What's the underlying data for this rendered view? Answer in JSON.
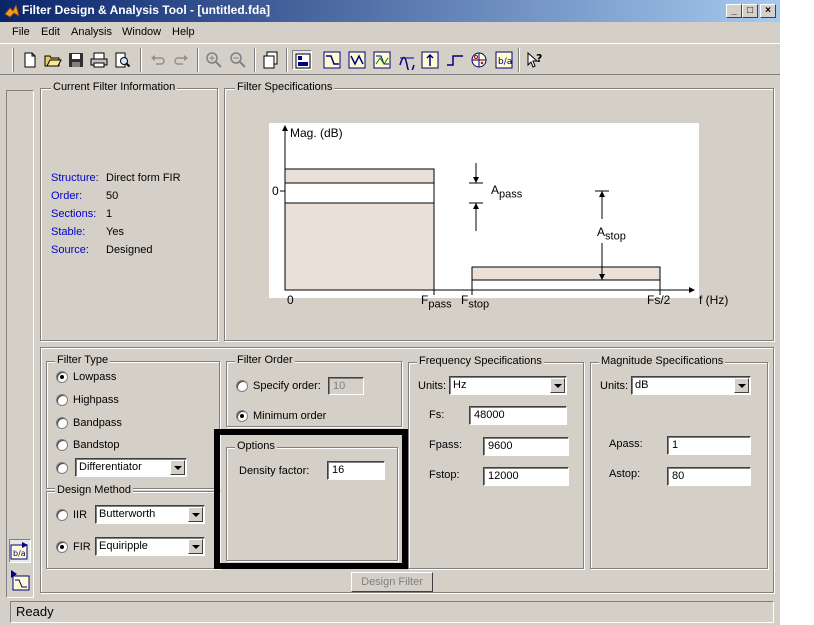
{
  "window": {
    "title": "Filter Design & Analysis Tool - [untitled.fda]"
  },
  "titlebar_buttons": {
    "minimize": "_",
    "maximize": "□",
    "close": "×"
  },
  "menu": [
    "File",
    "Edit",
    "Analysis",
    "Window",
    "Help"
  ],
  "toolbar_icons": [
    "new-icon",
    "open-icon",
    "save-icon",
    "print-icon",
    "print-preview-icon",
    "undo-icon",
    "redo-icon",
    "zoom-in-icon",
    "zoom-out-icon",
    "new-figure-icon",
    "full-view-icon",
    "magnitude-response-icon",
    "phase-response-icon",
    "magnitude-phase-icon",
    "group-delay-icon",
    "impulse-response-icon",
    "step-response-icon",
    "pole-zero-icon",
    "filter-coefficients-icon",
    "whats-this-icon"
  ],
  "current_filter": {
    "legend": "Current Filter Information",
    "rows": [
      {
        "label": "Structure:",
        "value": "Direct form FIR"
      },
      {
        "label": "Order:",
        "value": "50"
      },
      {
        "label": "Sections:",
        "value": "1"
      },
      {
        "label": "Stable:",
        "value": "Yes"
      },
      {
        "label": "Source:",
        "value": "Designed"
      }
    ]
  },
  "filter_specs": {
    "legend": "Filter Specifications",
    "ylabel": "Mag. (dB)",
    "zero_y": "0",
    "zero_x": "0",
    "fpass": "F",
    "fpass_sub": "pass",
    "fstop": "F",
    "fstop_sub": "stop",
    "fs2": "Fs/2",
    "xlabel": "f (Hz)",
    "apass": "A",
    "apass_sub": "pass",
    "astop": "A",
    "astop_sub": "stop"
  },
  "filter_type": {
    "legend": "Filter Type",
    "options": [
      "Lowpass",
      "Highpass",
      "Bandpass",
      "Bandstop"
    ],
    "selected": 0,
    "differentiator": "Differentiator"
  },
  "design_method": {
    "legend": "Design Method",
    "iir_label": "IIR",
    "iir_value": "Butterworth",
    "fir_label": "FIR",
    "fir_value": "Equiripple",
    "selected": "FIR"
  },
  "filter_order": {
    "legend": "Filter Order",
    "specify_label": "Specify order:",
    "specify_value": "10",
    "minimum_label": "Minimum order",
    "selected": "minimum"
  },
  "options": {
    "legend": "Options",
    "density_label": "Density factor:",
    "density_value": "16"
  },
  "frequency_specs": {
    "legend": "Frequency Specifications",
    "units_label": "Units:",
    "units_value": "Hz",
    "fs_label": "Fs:",
    "fs_value": "48000",
    "fpass_label": "Fpass:",
    "fpass_value": "9600",
    "fstop_label": "Fstop:",
    "fstop_value": "12000"
  },
  "magnitude_specs": {
    "legend": "Magnitude Specifications",
    "units_label": "Units:",
    "units_value": "dB",
    "apass_label": "Apass:",
    "apass_value": "1",
    "astop_label": "Astop:",
    "astop_value": "80"
  },
  "design_button": "Design Filter",
  "status": "Ready",
  "colors": {
    "title_start": "#0a246a",
    "title_end": "#a6caf0",
    "face": "#d4d0c8",
    "label_blue": "#0000c8",
    "band_fill": "#ebe0d8"
  }
}
